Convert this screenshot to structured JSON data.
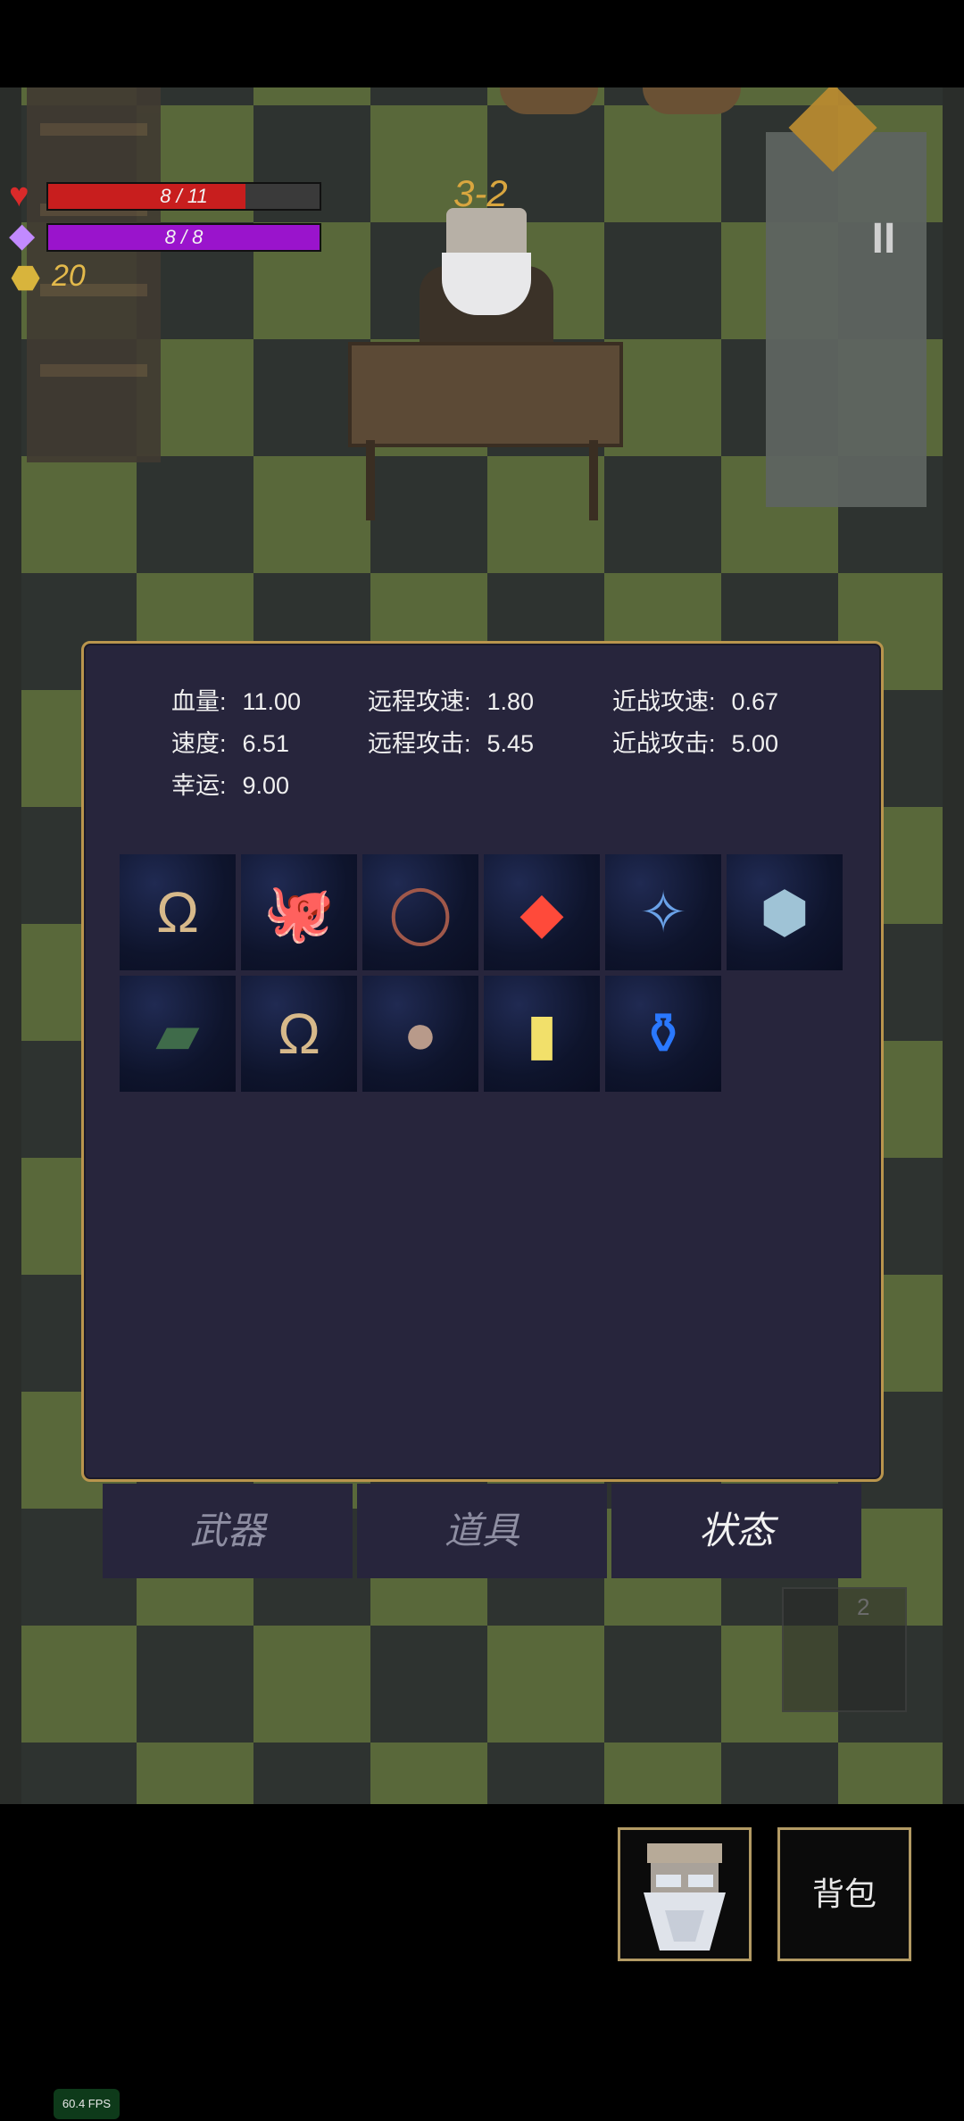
{
  "hud": {
    "hp_text": "8 / 11",
    "hp_fraction": 0.727,
    "mp_text": "8 / 8",
    "mp_fraction": 1.0,
    "gold": "20",
    "level": "3-2",
    "pause_symbol": "II"
  },
  "stats": {
    "hp": {
      "label": "血量:",
      "value": "11.00"
    },
    "ranged_speed": {
      "label": "远程攻速:",
      "value": "1.80"
    },
    "melee_speed": {
      "label": "近战攻速:",
      "value": "0.67"
    },
    "speed": {
      "label": "速度:",
      "value": "6.51"
    },
    "ranged_attack": {
      "label": "远程攻击:",
      "value": "5.45"
    },
    "melee_attack": {
      "label": "近战攻击:",
      "value": "5.00"
    },
    "luck": {
      "label": "幸运:",
      "value": "9.00"
    }
  },
  "items": [
    {
      "icon": "horseshoe-icon",
      "glyph": "Ω",
      "color": "#d7b98a"
    },
    {
      "icon": "octopus-icon",
      "glyph": "🐙",
      "color": "#9aa898"
    },
    {
      "icon": "thorn-crown-icon",
      "glyph": "◯",
      "color": "#a0584a"
    },
    {
      "icon": "red-crystal-icon",
      "glyph": "◆",
      "color": "#ff4a3a"
    },
    {
      "icon": "dragonfly-icon",
      "glyph": "✧",
      "color": "#6aa2e8"
    },
    {
      "icon": "stone-icon",
      "glyph": "⬢",
      "color": "#9fc3d6"
    },
    {
      "icon": "book-icon",
      "glyph": "▰",
      "color": "#3f6b4a"
    },
    {
      "icon": "horseshoe-icon",
      "glyph": "Ω",
      "color": "#d7b98a"
    },
    {
      "icon": "pouch-icon",
      "glyph": "●",
      "color": "#b89a8a"
    },
    {
      "icon": "yellow-card-icon",
      "glyph": "▮",
      "color": "#f2e06a"
    },
    {
      "icon": "blue-potion-icon",
      "glyph": "⚱",
      "color": "#2a78ff"
    }
  ],
  "tabs": [
    {
      "label": "武器",
      "active": false
    },
    {
      "label": "道具",
      "active": false
    },
    {
      "label": "状态",
      "active": true
    }
  ],
  "shadow_item_count": "2",
  "bag_label": "背包",
  "fps": "60.4 FPS"
}
